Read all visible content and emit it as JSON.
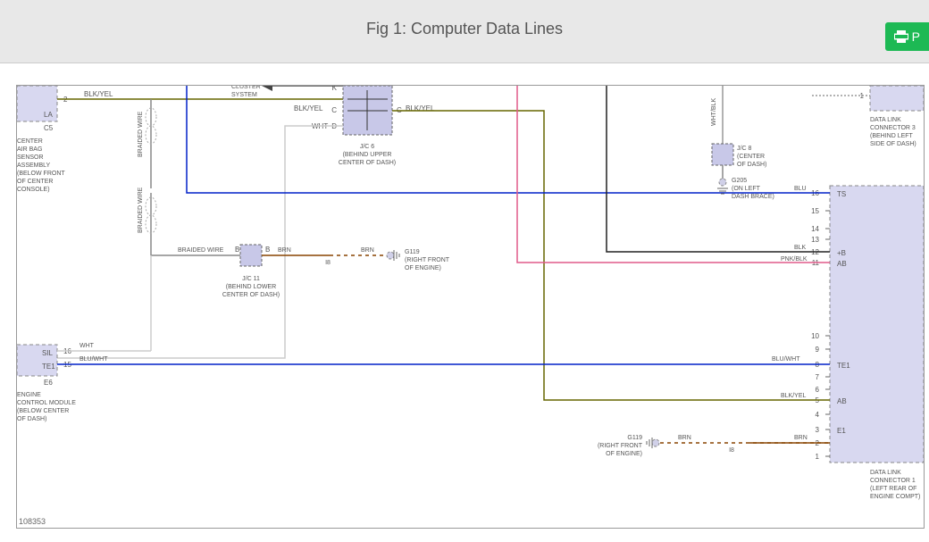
{
  "title": "Fig 1: Computer Data Lines",
  "printLabel": "P",
  "footerId": "108353",
  "components": {
    "airbag": {
      "name": "CENTER AIR BAG SENSOR ASSEMBLY",
      "location": "(BELOW FRONT OF CENTER CONSOLE)",
      "pin": "2",
      "conn": "C5",
      "signal": "LA"
    },
    "ecm": {
      "name": "ENGINE CONTROL MODULE",
      "location": "(BELOW CENTER OF DASH)",
      "pins": {
        "p16": "16",
        "p15": "15"
      },
      "conn": "E6",
      "signals": {
        "sil": "SIL",
        "te1": "TE1"
      }
    },
    "dlc3": {
      "name": "DATA LINK CONNECTOR 3",
      "location": "(BEHIND LEFT SIDE OF DASH)",
      "pin": "1"
    },
    "dlc1": {
      "name": "DATA LINK CONNECTOR 1",
      "location": "(LEFT REAR OF ENGINE COMPT)",
      "pins": {
        "p16": "16",
        "p15": "15",
        "p14": "14",
        "p13": "13",
        "p12": "12",
        "p11": "11",
        "p10": "10",
        "p9": "9",
        "p8": "8",
        "p7": "7",
        "p6": "6",
        "p5": "5",
        "p4": "4",
        "p3": "3",
        "p2": "2",
        "p1": "1"
      },
      "signals": {
        "ts": "TS",
        "plusb": "+B",
        "ab": "AB",
        "te1": "TE1",
        "ab2": "AB",
        "e1": "E1"
      }
    }
  },
  "junctions": {
    "jc6": {
      "name": "J/C 6",
      "location": "(BEHIND UPPER CENTER OF DASH)",
      "pins": {
        "k": "K",
        "c": "C",
        "d": "D"
      }
    },
    "jc8": {
      "name": "J/C 8",
      "location": "(CENTER OF DASH)"
    },
    "jc11": {
      "name": "J/C 11",
      "location": "(BEHIND LOWER CENTER OF DASH)",
      "pin": "B"
    }
  },
  "grounds": {
    "g205": {
      "name": "G205",
      "location": "(ON LEFT DASH BRACE)"
    },
    "g119a": {
      "name": "G119",
      "location": "(RIGHT FRONT OF ENGINE)",
      "conn": "I8"
    },
    "g119b": {
      "name": "G119",
      "location": "(RIGHT FRONT OF ENGINE)",
      "conn": "I8"
    }
  },
  "wires": {
    "blkyel": "BLK/YEL",
    "wht": "WHT",
    "blu": "BLU",
    "blk": "BLK",
    "pnkblk": "PNK/BLK",
    "brn": "BRN",
    "bluwht": "BLU/WHT",
    "whtblk": "WHT/BLK",
    "braided": "BRAIDED WIRE",
    "braidedV": "BRAIDED WIRE",
    "cluster": "CLUSTER SYSTEM"
  }
}
